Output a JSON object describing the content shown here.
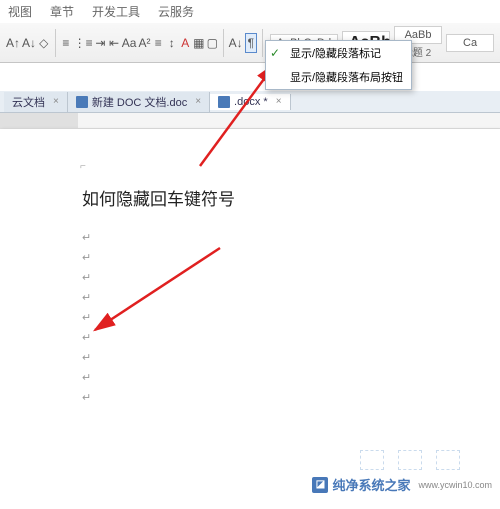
{
  "menu": {
    "items": [
      "视图",
      "章节",
      "开发工具",
      "云服务"
    ]
  },
  "ribbon": {
    "style_preview": "AaBbCcDd",
    "style_big": "AaBb",
    "style_h2_preview": "AaBb",
    "style_default": "Ca",
    "heading2_label": "标题 2"
  },
  "dropdown": {
    "item1": "显示/隐藏段落标记",
    "item2": "显示/隐藏段落布局按钮"
  },
  "tabs": {
    "tab1": "云文档",
    "tab2": "新建 DOC 文档.doc",
    "tab3": ".docx *"
  },
  "document": {
    "text": "如何隐藏回车键符号",
    "para_mark": "↵"
  },
  "watermark": {
    "brand": "纯净系统之家",
    "url": "www.ycwin10.com"
  }
}
